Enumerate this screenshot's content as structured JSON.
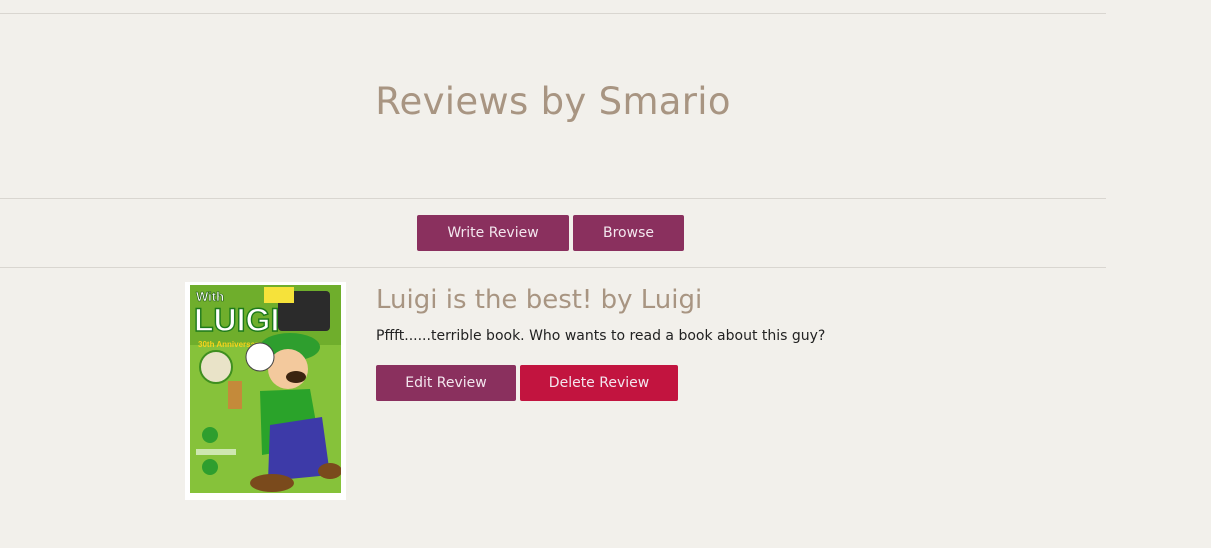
{
  "header": {
    "title": "Reviews by Smario"
  },
  "nav": {
    "write_review_label": "Write Review",
    "browse_label": "Browse"
  },
  "review": {
    "title": "Luigi is the best! by Luigi",
    "body": "Pffft......terrible book. Who wants to read a book about this guy?",
    "edit_label": "Edit Review",
    "delete_label": "Delete Review",
    "cover": {
      "icon": "book-cover-image",
      "text_top": "With",
      "text_main": "LUIGI",
      "text_sub": "30th Anniversary"
    }
  },
  "colors": {
    "background": "#f2f0eb",
    "heading": "#a89582",
    "button_primary": "#8a305e",
    "button_danger": "#c2143f"
  }
}
